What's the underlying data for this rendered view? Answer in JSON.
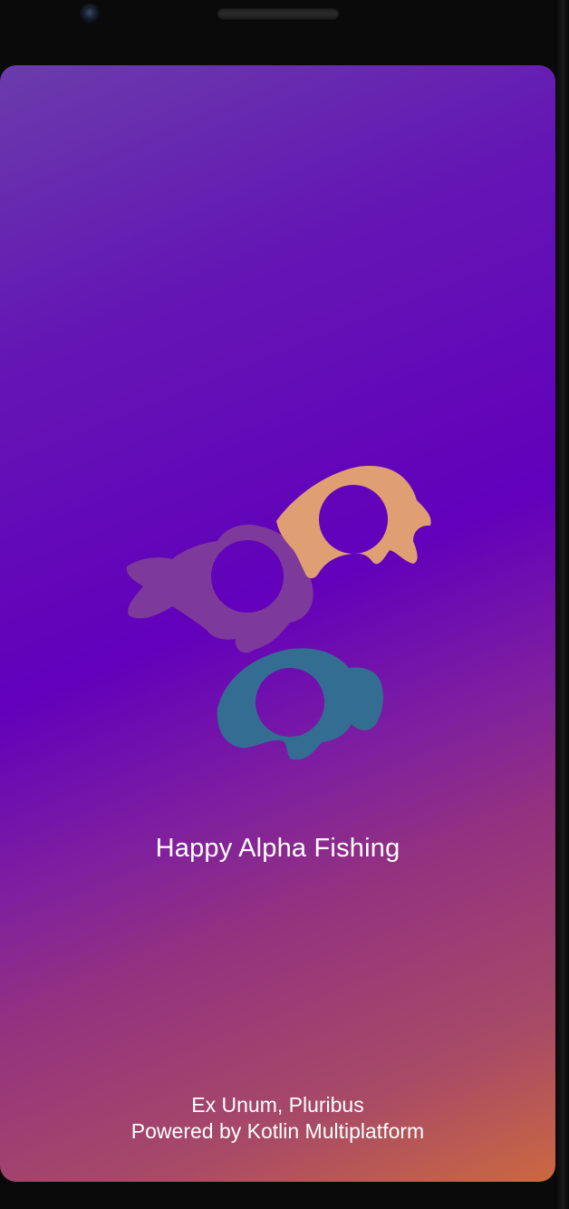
{
  "app": {
    "title": "Happy Alpha Fishing",
    "motto": "Ex Unum, Pluribus",
    "powered_by": "Powered by Kotlin Multiplatform"
  },
  "logo": {
    "icon": "fish-logo-icon",
    "fish_colors": {
      "purple": "#7e3a9b",
      "orange": "#e09f72",
      "teal": "#336e92"
    }
  },
  "theme": {
    "gradient_top": "#6a3cab",
    "gradient_mid": "#6200bb",
    "gradient_bottom": "#cb6840"
  }
}
